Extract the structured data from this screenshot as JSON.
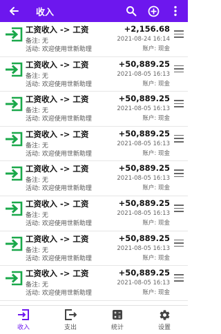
{
  "appbar": {
    "title": "收入",
    "back_icon": "arrow-left-icon",
    "search_icon": "search-icon",
    "add_icon": "add-circle-icon",
    "more_icon": "more-vert-icon",
    "color": "#6d17ee"
  },
  "records": [
    {
      "name": "工资收入 -> 工资",
      "memo": "备注: 无",
      "activity": "活动: 欢迎使用世新助理",
      "amount": "+2,156.68",
      "date": "2021-08-24 16:14",
      "account": "账户: 现金"
    },
    {
      "name": "工资收入 -> 工资",
      "memo": "备注: 无",
      "activity": "活动: 欢迎使用世新助理",
      "amount": "+50,889.25",
      "date": "2021-08-05 16:13",
      "account": "账户: 现金"
    },
    {
      "name": "工资收入 -> 工资",
      "memo": "备注: 无",
      "activity": "活动: 欢迎使用世新助理",
      "amount": "+50,889.25",
      "date": "2021-08-05 16:13",
      "account": "账户: 现金"
    },
    {
      "name": "工资收入 -> 工资",
      "memo": "备注: 无",
      "activity": "活动: 欢迎使用世新助理",
      "amount": "+50,889.25",
      "date": "2021-08-05 16:13",
      "account": "账户: 现金"
    },
    {
      "name": "工资收入 -> 工资",
      "memo": "备注: 无",
      "activity": "活动: 欢迎使用世新助理",
      "amount": "+50,889.25",
      "date": "2021-08-05 16:13",
      "account": "账户: 现金"
    },
    {
      "name": "工资收入 -> 工资",
      "memo": "备注: 无",
      "activity": "活动: 欢迎使用世新助理",
      "amount": "+50,889.25",
      "date": "2021-08-05 16:13",
      "account": "账户: 现金"
    },
    {
      "name": "工资收入 -> 工资",
      "memo": "备注: 无",
      "activity": "活动: 欢迎使用世新助理",
      "amount": "+50,889.25",
      "date": "2021-08-05 16:13",
      "account": "账户: 现金"
    },
    {
      "name": "工资收入 -> 工资",
      "memo": "备注: 无",
      "activity": "活动: 欢迎使用世新助理",
      "amount": "+50,889.25",
      "date": "2021-08-05 16:13",
      "account": "账户: 现金"
    }
  ],
  "record_icon": "income-login-icon",
  "record_icon_color": "#1aa84a",
  "bottom_nav": [
    {
      "label": "收入",
      "icon": "income-icon",
      "active": true
    },
    {
      "label": "支出",
      "icon": "expense-icon",
      "active": false
    },
    {
      "label": "统计",
      "icon": "calculator-icon",
      "active": false
    },
    {
      "label": "设置",
      "icon": "gear-icon",
      "active": false
    }
  ]
}
